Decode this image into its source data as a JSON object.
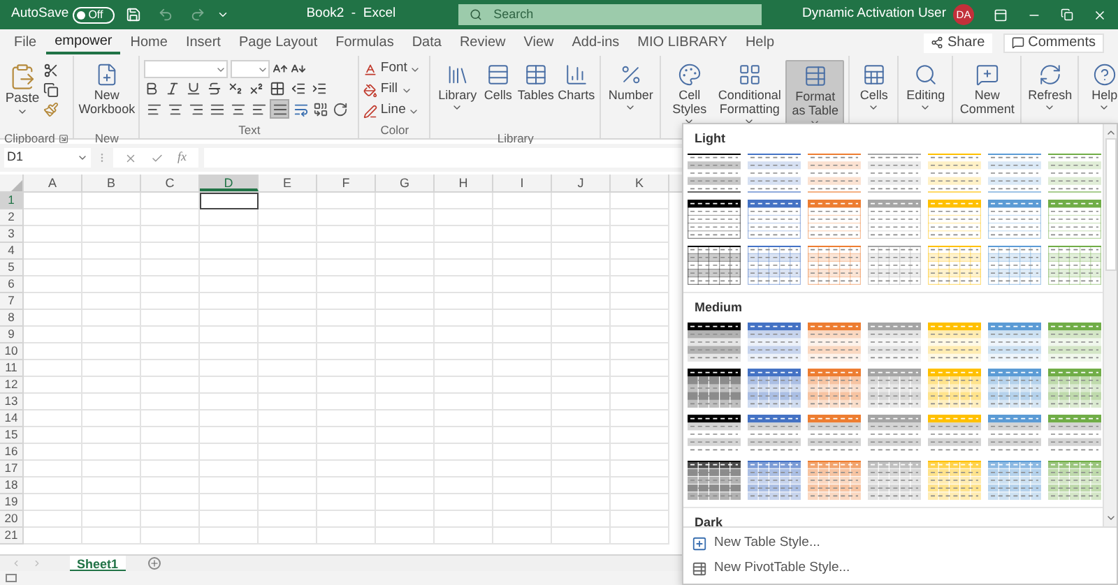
{
  "title_bar": {
    "autosave_label": "AutoSave",
    "autosave": {
      "on": false,
      "label": "Off"
    },
    "undo": {
      "disabled": true
    },
    "redo": {
      "disabled": true
    },
    "title": "Book2  -  Excel",
    "search": {
      "placeholder": "Search"
    },
    "user_name": "Dynamic Activation User",
    "avatar_initials": "DA"
  },
  "tabs": [
    {
      "label": "File",
      "selected": false
    },
    {
      "label": "empower",
      "selected": true
    },
    {
      "label": "Home",
      "selected": false
    },
    {
      "label": "Insert",
      "selected": false
    },
    {
      "label": "Page Layout",
      "selected": false
    },
    {
      "label": "Formulas",
      "selected": false
    },
    {
      "label": "Data",
      "selected": false
    },
    {
      "label": "Review",
      "selected": false
    },
    {
      "label": "View",
      "selected": false
    },
    {
      "label": "Add-ins",
      "selected": false
    },
    {
      "label": "MIO LIBRARY",
      "selected": false
    },
    {
      "label": "Help",
      "selected": false
    }
  ],
  "share": "Share",
  "comments": "Comments",
  "ribbon": {
    "groups": [
      {
        "kind": "clipboard",
        "label": "Clipboard",
        "paste": {
          "label": "Paste",
          "dropdown": true
        }
      },
      {
        "kind": "buttons",
        "label": "New",
        "items": [
          {
            "label": "New Workbook",
            "dropdown": false,
            "selected": false
          }
        ]
      },
      {
        "kind": "text",
        "label": "Text",
        "align_buttons": [
          {
            "pressed": false
          },
          {
            "pressed": false
          },
          {
            "pressed": false
          },
          {
            "pressed": false
          },
          {
            "pressed": false
          },
          {
            "pressed": false
          },
          {
            "pressed": true
          }
        ]
      },
      {
        "kind": "color",
        "label": "Color",
        "items": [
          {
            "label": "Font"
          },
          {
            "label": "Fill"
          },
          {
            "label": "Line"
          }
        ]
      },
      {
        "kind": "buttons",
        "label": "Library",
        "items": [
          {
            "label": "Library",
            "dropdown": true,
            "selected": false
          },
          {
            "label": "Cells",
            "dropdown": false,
            "selected": false
          },
          {
            "label": "Tables",
            "dropdown": false,
            "selected": false
          },
          {
            "label": "Charts",
            "dropdown": false,
            "selected": false
          }
        ]
      },
      {
        "kind": "buttons",
        "items": [
          {
            "label": "Number",
            "dropdown": true,
            "selected": false
          }
        ]
      },
      {
        "kind": "buttons",
        "items": [
          {
            "label": "Cell Styles",
            "dropdown": true,
            "selected": false
          },
          {
            "label": "Conditional Formatting",
            "dropdown": true,
            "selected": false
          },
          {
            "label": "Format as Table",
            "dropdown": true,
            "selected": true
          }
        ]
      },
      {
        "kind": "buttons",
        "items": [
          {
            "label": "Cells",
            "dropdown": true,
            "selected": false
          }
        ]
      },
      {
        "kind": "buttons",
        "items": [
          {
            "label": "Editing",
            "dropdown": true,
            "selected": false
          }
        ]
      },
      {
        "kind": "buttons",
        "items": [
          {
            "label": "New Comment",
            "dropdown": false,
            "selected": false
          }
        ]
      },
      {
        "kind": "buttons",
        "items": [
          {
            "label": "Refresh",
            "dropdown": true,
            "selected": false
          }
        ]
      },
      {
        "kind": "buttons",
        "items": [
          {
            "label": "Help",
            "dropdown": true,
            "selected": false
          }
        ]
      }
    ]
  },
  "formula_bar": {
    "name_box": "D1",
    "fx": "fx"
  },
  "sheet": {
    "columns": [
      {
        "label": "A",
        "selected": false
      },
      {
        "label": "B",
        "selected": false
      },
      {
        "label": "C",
        "selected": false
      },
      {
        "label": "D",
        "selected": true
      },
      {
        "label": "E",
        "selected": false
      },
      {
        "label": "F",
        "selected": false
      },
      {
        "label": "G",
        "selected": false
      },
      {
        "label": "H",
        "selected": false
      },
      {
        "label": "I",
        "selected": false
      },
      {
        "label": "J",
        "selected": false
      },
      {
        "label": "K",
        "selected": false
      }
    ],
    "rows": [
      {
        "label": "1",
        "selected": true
      },
      {
        "label": "2",
        "selected": false
      },
      {
        "label": "3",
        "selected": false
      },
      {
        "label": "4",
        "selected": false
      },
      {
        "label": "5",
        "selected": false
      },
      {
        "label": "6",
        "selected": false
      },
      {
        "label": "7",
        "selected": false
      },
      {
        "label": "8",
        "selected": false
      },
      {
        "label": "9",
        "selected": false
      },
      {
        "label": "10",
        "selected": false
      },
      {
        "label": "11",
        "selected": false
      },
      {
        "label": "12",
        "selected": false
      },
      {
        "label": "13",
        "selected": false
      },
      {
        "label": "14",
        "selected": false
      },
      {
        "label": "15",
        "selected": false
      },
      {
        "label": "16",
        "selected": false
      },
      {
        "label": "17",
        "selected": false
      },
      {
        "label": "18",
        "selected": false
      },
      {
        "label": "19",
        "selected": false
      },
      {
        "label": "20",
        "selected": false
      },
      {
        "label": "21",
        "selected": false
      }
    ]
  },
  "sheet_tabs": [
    {
      "label": "Sheet1",
      "selected": true
    }
  ],
  "gallery": {
    "sections": [
      {
        "title": "Light",
        "rows": [
          {
            "kind": "banded",
            "styles": [
              {
                "color": "#000000"
              },
              {
                "color": "#4472c4"
              },
              {
                "color": "#ed7d31"
              },
              {
                "color": "#a5a5a5"
              },
              {
                "color": "#ffc000"
              },
              {
                "color": "#5b9bd5"
              },
              {
                "color": "#70ad47"
              }
            ]
          },
          {
            "kind": "header",
            "styles": [
              {
                "color": "#000000"
              },
              {
                "color": "#4472c4"
              },
              {
                "color": "#ed7d31"
              },
              {
                "color": "#a5a5a5"
              },
              {
                "color": "#ffc000"
              },
              {
                "color": "#5b9bd5"
              },
              {
                "color": "#70ad47"
              }
            ]
          },
          {
            "kind": "grid",
            "styles": [
              {
                "color": "#000000"
              },
              {
                "color": "#4472c4"
              },
              {
                "color": "#ed7d31"
              },
              {
                "color": "#a5a5a5"
              },
              {
                "color": "#ffc000"
              },
              {
                "color": "#5b9bd5"
              },
              {
                "color": "#70ad47"
              }
            ]
          }
        ]
      },
      {
        "title": "Medium",
        "rows": [
          {
            "kind": "header_banded",
            "styles": [
              {
                "color": "#000000"
              },
              {
                "color": "#4472c4"
              },
              {
                "color": "#ed7d31"
              },
              {
                "color": "#a5a5a5"
              },
              {
                "color": "#ffc000"
              },
              {
                "color": "#5b9bd5"
              },
              {
                "color": "#70ad47"
              }
            ]
          },
          {
            "kind": "header_shaded",
            "styles": [
              {
                "color": "#000000"
              },
              {
                "color": "#4472c4"
              },
              {
                "color": "#ed7d31"
              },
              {
                "color": "#a5a5a5"
              },
              {
                "color": "#ffc000"
              },
              {
                "color": "#5b9bd5"
              },
              {
                "color": "#70ad47"
              }
            ]
          },
          {
            "kind": "header_gray",
            "styles": [
              {
                "color": "#000000"
              },
              {
                "color": "#4472c4"
              },
              {
                "color": "#ed7d31"
              },
              {
                "color": "#a5a5a5"
              },
              {
                "color": "#ffc000"
              },
              {
                "color": "#5b9bd5"
              },
              {
                "color": "#70ad47"
              }
            ]
          },
          {
            "kind": "shaded_grid",
            "styles": [
              {
                "color": "#000000"
              },
              {
                "color": "#4472c4"
              },
              {
                "color": "#ed7d31"
              },
              {
                "color": "#a5a5a5"
              },
              {
                "color": "#ffc000"
              },
              {
                "color": "#5b9bd5"
              },
              {
                "color": "#70ad47"
              }
            ]
          }
        ]
      },
      {
        "title": "Dark"
      }
    ],
    "menu": [
      "New Table Style...",
      "New PivotTable Style..."
    ]
  }
}
